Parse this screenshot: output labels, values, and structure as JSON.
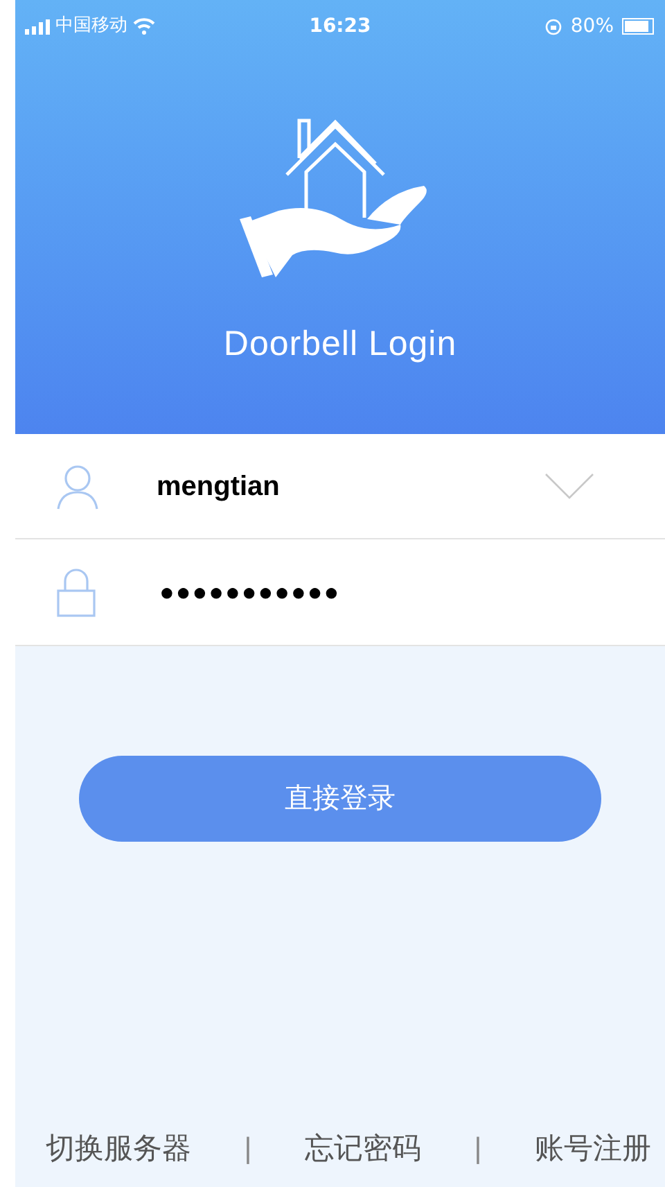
{
  "status_bar": {
    "carrier": "中国移动",
    "time": "16:23",
    "battery": "80%"
  },
  "header": {
    "title": "Doorbell Login"
  },
  "form": {
    "username": {
      "value": "mengtian"
    },
    "password": {
      "value": "●●●●●●●●●●●"
    }
  },
  "login_button": "直接登录",
  "footer": [
    {
      "kind": "link",
      "text": "切换服务器"
    },
    {
      "kind": "separator",
      "text": "|"
    },
    {
      "kind": "link",
      "text": "忘记密码"
    },
    {
      "kind": "separator",
      "text": "|"
    },
    {
      "kind": "link",
      "text": "账号注册"
    }
  ]
}
